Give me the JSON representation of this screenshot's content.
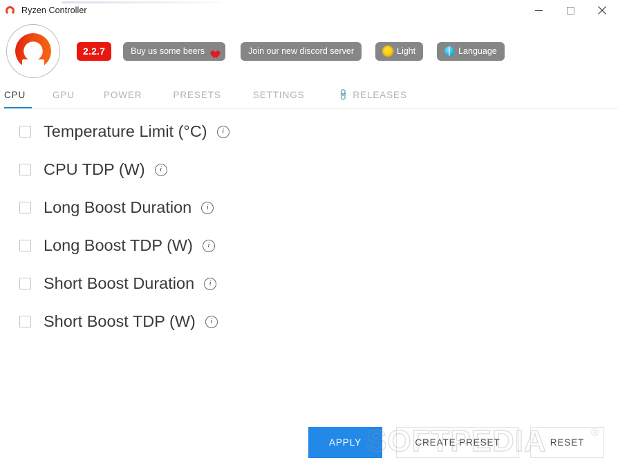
{
  "window": {
    "title": "Ryzen Controller",
    "icon": "app-logo-icon",
    "minimize_label": "─",
    "maximize_label": "□",
    "close_label": "✕"
  },
  "toolbar": {
    "logo_icon": "ryzen-controller-logo",
    "version": "2.2.7",
    "buttons": [
      {
        "id": "beers",
        "label": "Buy us some beers",
        "icon": "heart-icon"
      },
      {
        "id": "discord",
        "label": "Join our new discord server",
        "icon": ""
      },
      {
        "id": "theme",
        "label": "Light",
        "icon": "sun-icon"
      },
      {
        "id": "language",
        "label": "Language",
        "icon": "globe-icon"
      }
    ]
  },
  "tabs": [
    {
      "id": "cpu",
      "label": "CPU",
      "active": true,
      "icon": ""
    },
    {
      "id": "gpu",
      "label": "GPU",
      "active": false,
      "icon": ""
    },
    {
      "id": "power",
      "label": "POWER",
      "active": false,
      "icon": ""
    },
    {
      "id": "presets",
      "label": "PRESETS",
      "active": false,
      "icon": ""
    },
    {
      "id": "settings",
      "label": "SETTINGS",
      "active": false,
      "icon": ""
    },
    {
      "id": "releases",
      "label": "RELEASES",
      "active": false,
      "icon": "link-icon"
    }
  ],
  "settings_rows": [
    {
      "id": "temperature-limit",
      "label": "Temperature Limit (°C)",
      "checked": false,
      "info": "i"
    },
    {
      "id": "cpu-tdp",
      "label": "CPU TDP (W)",
      "checked": false,
      "info": "i"
    },
    {
      "id": "long-boost-duration",
      "label": "Long Boost Duration",
      "checked": false,
      "info": "i"
    },
    {
      "id": "long-boost-tdp",
      "label": "Long Boost TDP (W)",
      "checked": false,
      "info": "i"
    },
    {
      "id": "short-boost-duration",
      "label": "Short Boost Duration",
      "checked": false,
      "info": "i"
    },
    {
      "id": "short-boost-tdp",
      "label": "Short Boost TDP (W)",
      "checked": false,
      "info": "i"
    }
  ],
  "footer": {
    "apply_label": "APPLY",
    "create_preset_label": "CREATE PRESET",
    "reset_label": "RESET"
  },
  "watermark": {
    "text": "SOFTPEDIA",
    "mark": "®"
  },
  "colors": {
    "accent_blue": "#2389e8",
    "tab_underline": "#1e88c7",
    "version_red": "#e8170f",
    "pill_gray": "#868686",
    "logo_red": "#e01f10",
    "logo_orange": "#f86a12"
  }
}
